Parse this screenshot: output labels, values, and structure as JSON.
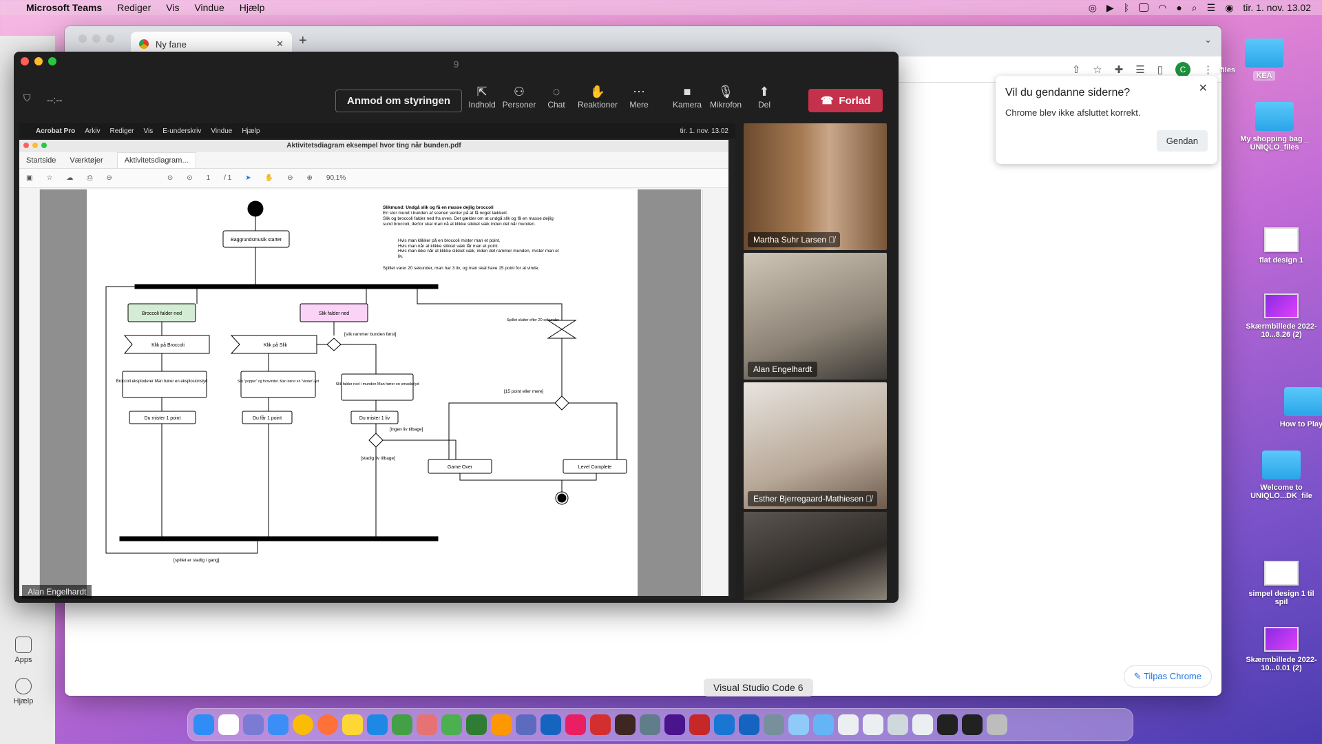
{
  "menubar": {
    "app": "Microsoft Teams",
    "items": [
      "Rediger",
      "Vis",
      "Vindue",
      "Hjælp"
    ],
    "datetime": "tir. 1. nov. 13.02"
  },
  "chrome": {
    "tab_title": "Ny fane",
    "restore_title": "Vil du gendanne siderne?",
    "restore_text": "Chrome blev ikke afsluttet korrekt.",
    "restore_button": "Gendan",
    "customize": "Tilpas Chrome",
    "avatar": "C"
  },
  "teams": {
    "window_number": "9",
    "timer": "--:--",
    "request_control": "Anmod om styringen",
    "controls": [
      "Indhold",
      "Personer",
      "Chat",
      "Reaktioner",
      "Mere",
      "Kamera",
      "Mikrofon",
      "Del"
    ],
    "leave": "Forlad",
    "rail": [
      "Apps",
      "Hjælp"
    ],
    "presenter": "Alan Engelhardt"
  },
  "acrobat": {
    "menubar": [
      "Acrobat Pro",
      "Arkiv",
      "Rediger",
      "Vis",
      "E-underskriv",
      "Vindue",
      "Hjælp"
    ],
    "datetime": "tir. 1. nov. 13.02",
    "title": "Aktivitetsdiagram eksempel hvor ting når bunden.pdf",
    "tabs": [
      "Startside",
      "Værktøjer",
      "Aktivitetsdiagram..."
    ],
    "page": "1",
    "pages": "/ 1",
    "zoom": "90,1%"
  },
  "diagram": {
    "heading": "Slikmund: Undgå slik og få en masse dejlig broccoli",
    "p1": "En stor mund i bunden af scenen venter på at få noget lækkert.",
    "p2": "Slik og broccoli falder ned fra oven. Det gælder om at undgå slik og få en masse dejlig sund broccoli, derfor skal man nå at klikke slikket væk inden det når munden.",
    "bullets": [
      "Hvis man klikker på en broccoli mister man et point.",
      "Hvis man når at klikke slikket væk får man et point.",
      "Hvis man ikke når at klikke slikket væk, inden det rammer munden, mister man et liv."
    ],
    "p3": "Spillet varer 20 sekunder, man har 3 liv, og man skal have 15 point for at vinde.",
    "nodes": {
      "start": "Baggrundsmusik starter",
      "broccoli_falls": "Broccoli falder ned",
      "candy_falls": "Slik falder ned",
      "click_broccoli": "Klik på Broccoli",
      "click_candy": "Klik på Slik",
      "broccoli_explodes": "Broccoli eksploderer Man hører en eksplosionslyd",
      "candy_pops": "Slik \"popper\" og forsvinder. Man hører en \"vinder\"-lyd",
      "candy_mouth": "Slik falder ned i munden Man hører en smaskelyd",
      "lose_point": "Du mister 1 point",
      "get_point": "Du får 1 point",
      "lose_life": "Du mister 1 liv",
      "game_over": "Game Over",
      "level_complete": "Level Complete",
      "timer_end": "Spillet slutter efter 20 sekunder"
    },
    "guards": {
      "hits_bottom": "[slik rammer bunden først]",
      "points15": "[15 point eller mere]",
      "no_lives": "[ingen liv tilbage]",
      "lives_left": "[stadig liv tilbage]",
      "still_running": "[spillet er stadig i gang]"
    }
  },
  "participants": [
    {
      "name": "Martha Suhr Larsen"
    },
    {
      "name": "Alan Engelhardt"
    },
    {
      "name": "Esther Bjerregaard-Mathiesen"
    },
    {
      "name": ""
    }
  ],
  "desktop": {
    "icons": [
      "My shopping bag _ UNIQLO_files",
      "flat design 1",
      "Skærmbillede 2022-10...8.26 (2)",
      "How to Play_",
      "Welcome to UNIQLO...DK_file",
      "simpel design 1 til spil",
      "Skærmbillede 2022-10...0.01 (2)"
    ],
    "badge": "KEA",
    "files_label": "_files"
  },
  "dock": {
    "tooltip": "Visual Studio Code 6"
  }
}
